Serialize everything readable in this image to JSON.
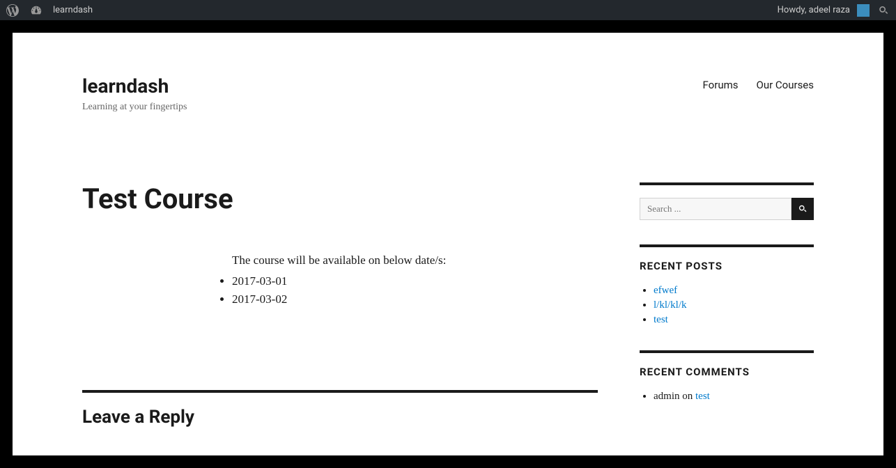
{
  "adminBar": {
    "siteName": "learndash",
    "howdy": "Howdy, adeel raza"
  },
  "site": {
    "title": "learndash",
    "tagline": "Learning at your fingertips"
  },
  "nav": {
    "forums": "Forums",
    "courses": "Our Courses"
  },
  "post": {
    "title": "Test Course",
    "intro": "The course will be available on below date/s:",
    "dates": [
      "2017-03-01",
      "2017-03-02"
    ]
  },
  "reply": {
    "title": "Leave a Reply"
  },
  "search": {
    "placeholder": "Search ..."
  },
  "widgets": {
    "recentPosts": {
      "title": "RECENT POSTS",
      "items": [
        "efwef",
        "l/kl/kl/k",
        "test"
      ]
    },
    "recentComments": {
      "title": "RECENT COMMENTS",
      "items": [
        {
          "author": "admin",
          "on": " on ",
          "post": "test"
        }
      ]
    }
  }
}
